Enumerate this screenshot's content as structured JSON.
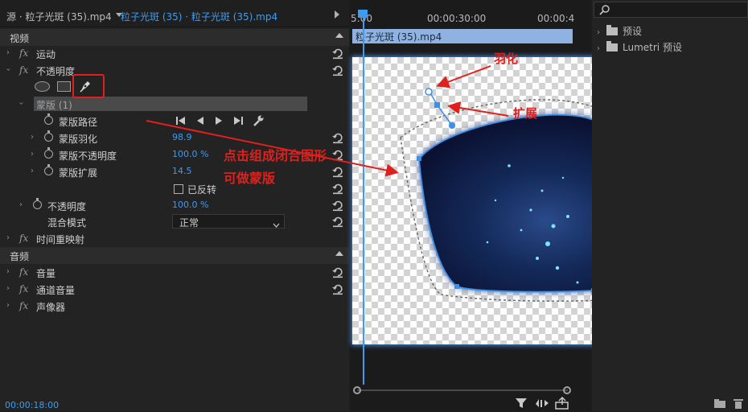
{
  "tabs": {
    "source": "源 · 粒子光斑 (35).mp4",
    "active": "粒子光斑 (35) · 粒子光斑 (35).mp4"
  },
  "effects": {
    "video_section": "视频",
    "motion": "运动",
    "opacity": "不透明度",
    "mask": "蒙版 (1)",
    "mask_path": "蒙版路径",
    "mask_feather": {
      "label": "蒙版羽化",
      "value": "98.9"
    },
    "mask_opacity": {
      "label": "蒙版不透明度",
      "value": "100.0 %"
    },
    "mask_expansion": {
      "label": "蒙版扩展",
      "value": "14.5"
    },
    "inverted": "已反转",
    "opacity_value": {
      "label": "不透明度",
      "value": "100.0 %"
    },
    "blend_mode": {
      "label": "混合模式",
      "value": "正常"
    },
    "time_remap": "时间重映射",
    "audio_section": "音频",
    "volume": "音量",
    "channel_volume": "通道音量",
    "panner": "声像器",
    "fx_symbol": "fx"
  },
  "timecode": "00:00:18:00",
  "monitor": {
    "ruler_labels": [
      "5:00",
      "00:00:30:00",
      "00:00:4"
    ],
    "clip_name": "粒子光斑 (35).mp4"
  },
  "annotations": {
    "feather": "羽化",
    "expand": "扩展",
    "instruction_line1": "点击组成闭合图形",
    "instruction_line2": "可做蒙版"
  },
  "project": {
    "items": [
      "预设",
      "Lumetri 预设"
    ]
  },
  "colors": {
    "accent": "#3d9cf0",
    "annotation": "#e0201c"
  }
}
